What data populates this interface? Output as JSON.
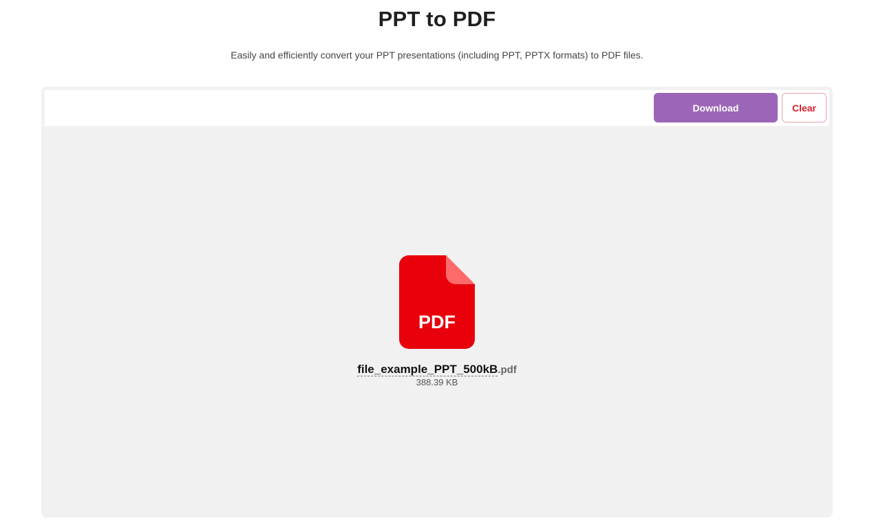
{
  "header": {
    "title": "PPT to PDF",
    "subtitle": "Easily and efficiently convert your PPT presentations (including PPT, PPTX formats) to PDF files."
  },
  "toolbar": {
    "download_label": "Download",
    "clear_label": "Clear"
  },
  "file": {
    "icon": "pdf-file-icon",
    "icon_label": "PDF",
    "name": "file_example_PPT_500kB",
    "extension": ".pdf",
    "size": "388.39 KB"
  },
  "colors": {
    "accent": "#9b66b8",
    "danger": "#d01f2e",
    "pdf_red": "#e8000b",
    "pdf_fold": "#ff6b6b",
    "panel_bg": "#f1f1f1"
  }
}
